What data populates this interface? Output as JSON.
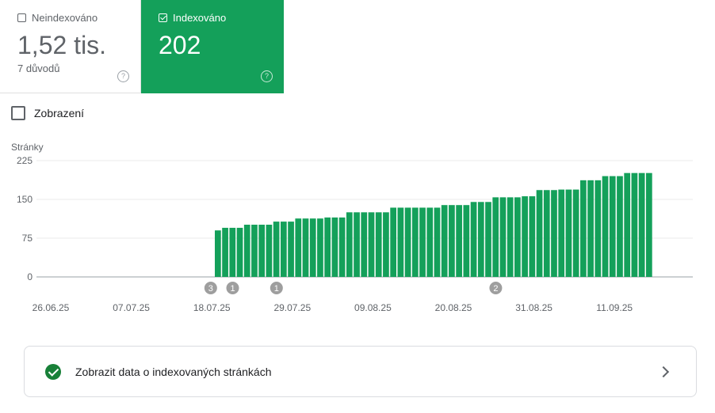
{
  "cards": {
    "nonindexed": {
      "label": "Neindexováno",
      "value": "1,52 tis.",
      "sub": "7 důvodů",
      "checked": false
    },
    "indexed": {
      "label": "Indexováno",
      "value": "202",
      "checked": true
    }
  },
  "help_glyph": "?",
  "impressions_toggle": {
    "label": "Zobrazení",
    "checked": false
  },
  "chart_data": {
    "type": "bar",
    "ylabel": "Stránky",
    "ylim": [
      0,
      225
    ],
    "yticks": [
      "225",
      "150",
      "75",
      "0"
    ],
    "xticks": [
      "26.06.25",
      "07.07.25",
      "18.07.25",
      "29.07.25",
      "09.08.25",
      "20.08.25",
      "31.08.25",
      "11.09.25"
    ],
    "first_date": "26.06.25",
    "values": [
      0,
      0,
      0,
      0,
      0,
      0,
      0,
      0,
      0,
      0,
      0,
      0,
      0,
      0,
      0,
      0,
      0,
      0,
      0,
      0,
      0,
      0,
      0,
      90,
      95,
      95,
      95,
      101,
      101,
      101,
      101,
      107,
      107,
      107,
      113,
      113,
      113,
      113,
      115,
      115,
      115,
      125,
      125,
      125,
      125,
      125,
      125,
      134,
      134,
      134,
      134,
      134,
      134,
      134,
      139,
      139,
      139,
      139,
      145,
      145,
      145,
      154,
      154,
      154,
      154,
      156,
      156,
      168,
      168,
      168,
      169,
      169,
      169,
      187,
      187,
      187,
      195,
      195,
      195,
      201,
      201,
      201,
      201
    ],
    "annotations": [
      {
        "date": "18.07.25",
        "label": "3"
      },
      {
        "date": "21.07.25",
        "label": "1"
      },
      {
        "date": "27.07.25",
        "label": "1"
      },
      {
        "date": "26.08.25",
        "label": "2"
      }
    ],
    "color": "#14a05a"
  },
  "link_card": {
    "text": "Zobrazit data o indexovaných stránkách",
    "icon": "check-circle-icon"
  },
  "colors": {
    "accent": "#14a05a",
    "check": "#188038"
  }
}
